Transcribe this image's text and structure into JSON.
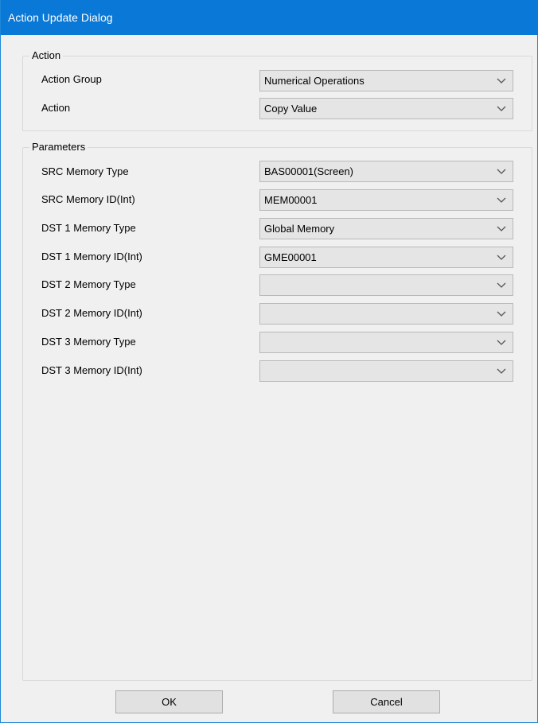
{
  "window": {
    "title": "Action Update Dialog"
  },
  "action_group": {
    "legend": "Action",
    "fields": [
      {
        "label": "Action Group",
        "value": "Numerical Operations"
      },
      {
        "label": "Action",
        "value": "Copy Value"
      }
    ]
  },
  "parameters_group": {
    "legend": "Parameters",
    "fields": [
      {
        "label": "SRC Memory Type",
        "value": "BAS00001(Screen)"
      },
      {
        "label": "SRC Memory ID(Int)",
        "value": "MEM00001"
      },
      {
        "label": "DST 1 Memory Type",
        "value": "Global Memory"
      },
      {
        "label": "DST 1 Memory ID(Int)",
        "value": "GME00001"
      },
      {
        "label": "DST 2 Memory Type",
        "value": ""
      },
      {
        "label": "DST 2 Memory ID(Int)",
        "value": ""
      },
      {
        "label": "DST 3 Memory Type",
        "value": ""
      },
      {
        "label": "DST 3 Memory ID(Int)",
        "value": ""
      }
    ]
  },
  "buttons": {
    "ok_label": "OK",
    "cancel_label": "Cancel"
  },
  "icons": {
    "dropdown": "chevron-down-icon"
  },
  "colors": {
    "titlebar": "#0a78d7",
    "window_bg": "#f0f0f0",
    "combo_bg": "#e5e5e5"
  }
}
